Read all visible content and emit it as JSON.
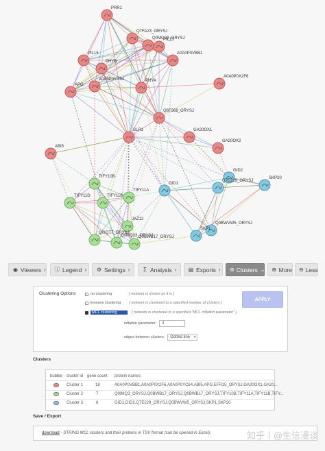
{
  "network": {
    "nodes": [
      {
        "label": "PRR1",
        "color": "red"
      },
      {
        "label": "Q7FA23_ORYSJ",
        "color": "red"
      },
      {
        "label": "Q0MG09_ORYSJ",
        "color": "red"
      },
      {
        "label": "PIL13",
        "color": "red"
      },
      {
        "label": "A0A0P0VBB1",
        "color": "red"
      },
      {
        "label": "PIL15",
        "color": "red"
      },
      {
        "label": "PHYB",
        "color": "red"
      },
      {
        "label": "A0A0P0YC64",
        "color": "red"
      },
      {
        "label": "PHYA",
        "color": "red"
      },
      {
        "label": "APG",
        "color": "red"
      },
      {
        "label": "A0A0P0X2F6",
        "color": "red"
      },
      {
        "label": "Q6F368_ORYSJ",
        "color": "red"
      },
      {
        "label": "SLR1",
        "color": "red"
      },
      {
        "label": "GA20OX1",
        "color": "red"
      },
      {
        "label": "ABI5",
        "color": "red"
      },
      {
        "label": "GA20OX2",
        "color": "red"
      },
      {
        "label": "GID2",
        "color": "blue"
      },
      {
        "label": "Q7E229_ORYSJ",
        "color": "blue"
      },
      {
        "label": "SKP20",
        "color": "blue"
      },
      {
        "label": "TIFY10B",
        "color": "green"
      },
      {
        "label": "TIFY11A",
        "color": "green"
      },
      {
        "label": "GID1",
        "color": "blue"
      },
      {
        "label": "TIFY11D",
        "color": "green"
      },
      {
        "label": "TIFY11B",
        "color": "green"
      },
      {
        "label": "JAZ12",
        "color": "green"
      },
      {
        "label": "Q0IQT7_ORYSJ",
        "color": "green"
      },
      {
        "label": "Q0MQ33_ORYSJ",
        "color": "green"
      },
      {
        "label": "Q0BWVW5_ORYSJ",
        "color": "blue"
      },
      {
        "label": "Q0BWB17_ORYSJ",
        "color": "green"
      },
      {
        "label": "SKP1",
        "color": "blue"
      }
    ]
  },
  "toolbar": {
    "viewers": "Viewers",
    "legend": "Legend",
    "settings": "Settings",
    "analysis": "Analysis",
    "exports": "Exports",
    "clusters": "Clusters",
    "more": "More",
    "less": "Less"
  },
  "clustering_options": {
    "title": "Clustering Options",
    "no_clustering": {
      "label": "no clustering",
      "desc": "( network is shown as it is )"
    },
    "kmeans": {
      "label": "kmeans clustering",
      "desc": "( network is clustered to a specified number of clusters )"
    },
    "mcl": {
      "label": "MCL clustering",
      "desc": "( network is clustered to a specified \"MCL inflation parameter\" )"
    },
    "inflation_label": "inflation parameter:",
    "inflation_value": "3",
    "edges_label": "edges between clusters:",
    "edges_value": "Dotted line",
    "apply": "APPLY"
  },
  "clusters": {
    "heading": "Clusters",
    "headers": [
      "bubble",
      "cluster id",
      "gene count",
      "protein names"
    ],
    "rows": [
      {
        "id": "Cluster 1",
        "count": "18",
        "proteins": "A0A0P0VBB1,A0A0P0X2F6,A0A0P0YC64,ABI5,APG,EFR15_ORYSJ,GA20OX1,GA20...",
        "color": "#e88a8a"
      },
      {
        "id": "Cluster 2",
        "count": "7",
        "proteins": "Q0IMQ3_ORYSJ,Q0BWB17_ORYSJ,Q0BWB17_ORYSJ,TIFY10B,TIFY11A,TIFY11B,TIFY...",
        "color": "#9ad98a"
      },
      {
        "id": "Cluster 3",
        "count": "6",
        "proteins": "GID1,GID2,Q7E229_ORYSJ,Q0BWVW5_ORYSJ,SKP1,SKP20",
        "color": "#7fc4dc"
      }
    ]
  },
  "save_export": {
    "heading": "Save / Export",
    "download": "download",
    "description": "- STRING MCL clusters and their proteins in TSV format (can be opened in Excel)."
  },
  "watermark": {
    "site": "知乎",
    "author": "@生信漫谈"
  }
}
